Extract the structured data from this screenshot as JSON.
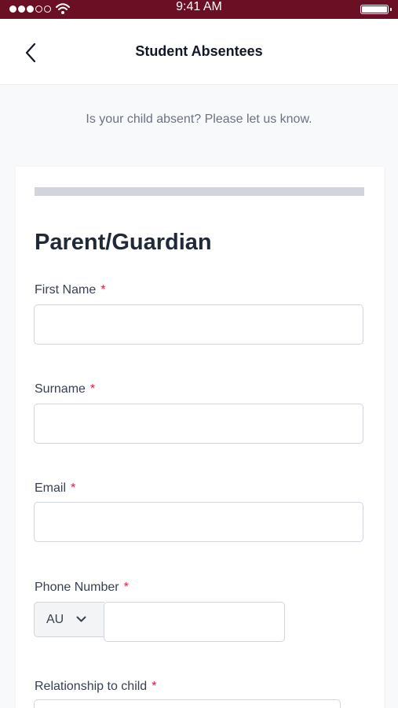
{
  "status_bar": {
    "time": "9:41 AM",
    "signal_bars": 5,
    "signal_filled": 3
  },
  "header": {
    "title": "Student Absentees",
    "back_icon": "chevron-left-icon"
  },
  "intro_text": "Is your child absent? Please let us know.",
  "form": {
    "section_title": "Parent/Guardian",
    "required_marker": "*",
    "fields": {
      "first_name": {
        "label": "First Name",
        "value": ""
      },
      "surname": {
        "label": "Surname",
        "value": ""
      },
      "email": {
        "label": "Email",
        "value": ""
      },
      "phone": {
        "label": "Phone Number",
        "country_code": "AU",
        "value": ""
      },
      "relationship": {
        "label": "Relationship to child",
        "value": ""
      }
    }
  },
  "colors": {
    "status_bar_bg": "#6b0f24",
    "required_marker": "#e11d48",
    "page_bg": "#f8f9fa"
  }
}
